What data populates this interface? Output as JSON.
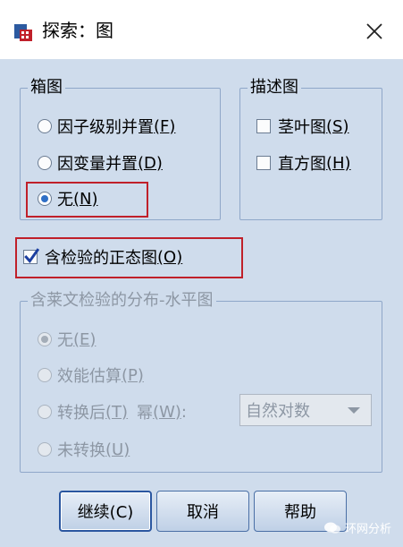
{
  "window": {
    "title": "探索：图"
  },
  "boxplot": {
    "legend": "箱图",
    "options": [
      {
        "label": "因子级别并置",
        "key": "(F)",
        "checked": false
      },
      {
        "label": "因变量并置",
        "key": "(D)",
        "checked": false
      },
      {
        "label": "无",
        "key": "(N)",
        "checked": true
      }
    ]
  },
  "descriptive": {
    "legend": "描述图",
    "options": [
      {
        "label": "茎叶图",
        "key": "(S)",
        "checked": false
      },
      {
        "label": "直方图",
        "key": "(H)",
        "checked": false
      }
    ]
  },
  "normality": {
    "label": "含检验的正态图",
    "key": "(O)",
    "checked": true
  },
  "spread_level": {
    "legend": "含莱文检验的分布-水平图",
    "options": [
      {
        "label": "无",
        "key": "(E)",
        "checked": true
      },
      {
        "label": "效能估算",
        "key": "(P)",
        "checked": false
      },
      {
        "label": "转换后",
        "key": "(T)",
        "checked": false
      },
      {
        "label": "未转换",
        "key": "(U)",
        "checked": false
      }
    ],
    "power_label": "幂",
    "power_key": "(W)",
    "power_colon": ":",
    "power_value": "自然对数"
  },
  "buttons": {
    "continue": "继续(C)",
    "cancel": "取消",
    "help": "帮助"
  },
  "watermark": "环网分析",
  "colors": {
    "accent": "#2f6fc6",
    "highlight": "#c0202a"
  }
}
